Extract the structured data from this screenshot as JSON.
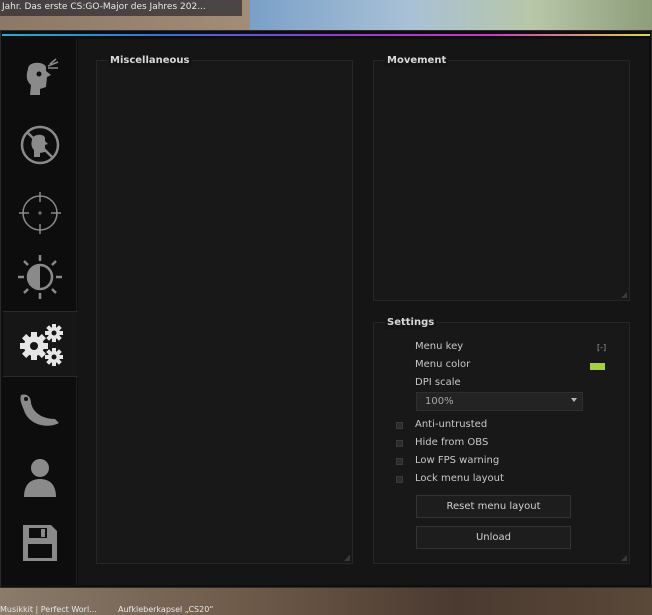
{
  "background": {
    "news_text": "Jahr. Das erste CS:GO-Major des Jahres 202...",
    "music_text": "Musikkit | Perfect Worl...",
    "sticker_text": "Aufkleberkapsel „CS20“"
  },
  "sidebar": {
    "tabs": [
      {
        "icon": "aimbot-headshot-icon"
      },
      {
        "icon": "antiaim-icon"
      },
      {
        "icon": "crosshair-icon"
      },
      {
        "icon": "brightness-visuals-icon"
      },
      {
        "icon": "gears-misc-icon",
        "active": true
      },
      {
        "icon": "knife-skins-icon"
      },
      {
        "icon": "player-icon"
      },
      {
        "icon": "floppy-disk-config-icon"
      }
    ]
  },
  "groups": {
    "miscellaneous": {
      "title": "Miscellaneous"
    },
    "movement": {
      "title": "Movement"
    },
    "settings": {
      "title": "Settings",
      "menu_key_label": "Menu key",
      "menu_key_value": "[-]",
      "menu_color_label": "Menu color",
      "menu_color": "#a4d23a",
      "dpi_label": "DPI scale",
      "dpi_value": "100%",
      "anti_untrusted": "Anti-untrusted",
      "hide_obs": "Hide from OBS",
      "low_fps": "Low FPS warning",
      "lock_layout": "Lock menu layout",
      "reset_button": "Reset menu layout",
      "unload_button": "Unload"
    }
  },
  "colors": {
    "accent": "#a4d23a",
    "panel": "#181818",
    "window": "#0e0e0e"
  }
}
